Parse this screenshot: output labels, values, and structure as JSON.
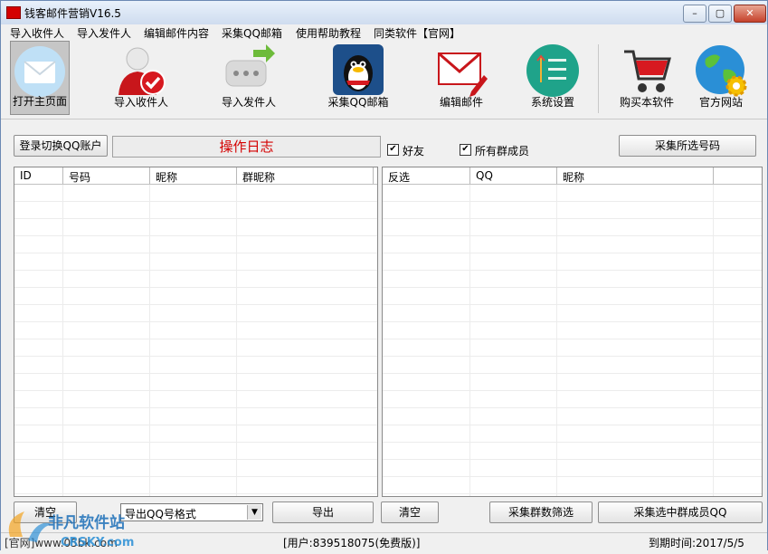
{
  "window": {
    "title": "钱客邮件营销V16.5",
    "controls": {
      "minimize": "–",
      "maximize": "▢",
      "close": "✕"
    }
  },
  "menu": [
    "导入收件人",
    "导入发件人",
    "编辑邮件内容",
    "采集QQ邮箱",
    "使用帮助教程",
    "同类软件【官网】"
  ],
  "toolbar": {
    "items": [
      {
        "label": "打开主页面",
        "icon": "envelope-icon",
        "active": true
      },
      {
        "label": "导入收件人",
        "icon": "user-check-icon"
      },
      {
        "label": "导入发件人",
        "icon": "chat-arrow-icon"
      },
      {
        "label": "采集QQ邮箱",
        "icon": "qq-penguin-icon"
      },
      {
        "label": "编辑邮件",
        "icon": "mail-edit-icon"
      },
      {
        "label": "系统设置",
        "icon": "settings-list-icon"
      },
      {
        "label": "购买本软件",
        "icon": "shopping-cart-icon"
      },
      {
        "label": "官方网站",
        "icon": "globe-gear-icon"
      }
    ]
  },
  "controls": {
    "login_button": "登录切换QQ账户",
    "log_title": "操作日志",
    "friends_checkbox": {
      "label": "好友",
      "checked": true
    },
    "all_members_checkbox": {
      "label": "所有群成员",
      "checked": true
    },
    "collect_selected_button": "采集所选号码"
  },
  "left_table": {
    "columns": [
      "ID",
      "号码",
      "昵称",
      "群昵称"
    ],
    "rows": []
  },
  "right_table": {
    "columns": [
      "反选",
      "QQ",
      "昵称"
    ],
    "rows": []
  },
  "bottom": {
    "clear_left": "清空",
    "export_format": "导出QQ号格式",
    "export_button": "导出",
    "clear_right": "清空",
    "filter_button": "采集群数筛选",
    "collect_members_button": "采集选中群成员QQ"
  },
  "status": {
    "left": "[官网]www.05bk.com",
    "user": "[用户:839518075(免费版)]",
    "expiry": "到期时间:2017/5/5"
  },
  "watermark": {
    "text": "非凡软件站",
    "sub": "CRSKY.com"
  },
  "colors": {
    "accent_red": "#d40000",
    "title_bg": "#dbe6f4"
  }
}
